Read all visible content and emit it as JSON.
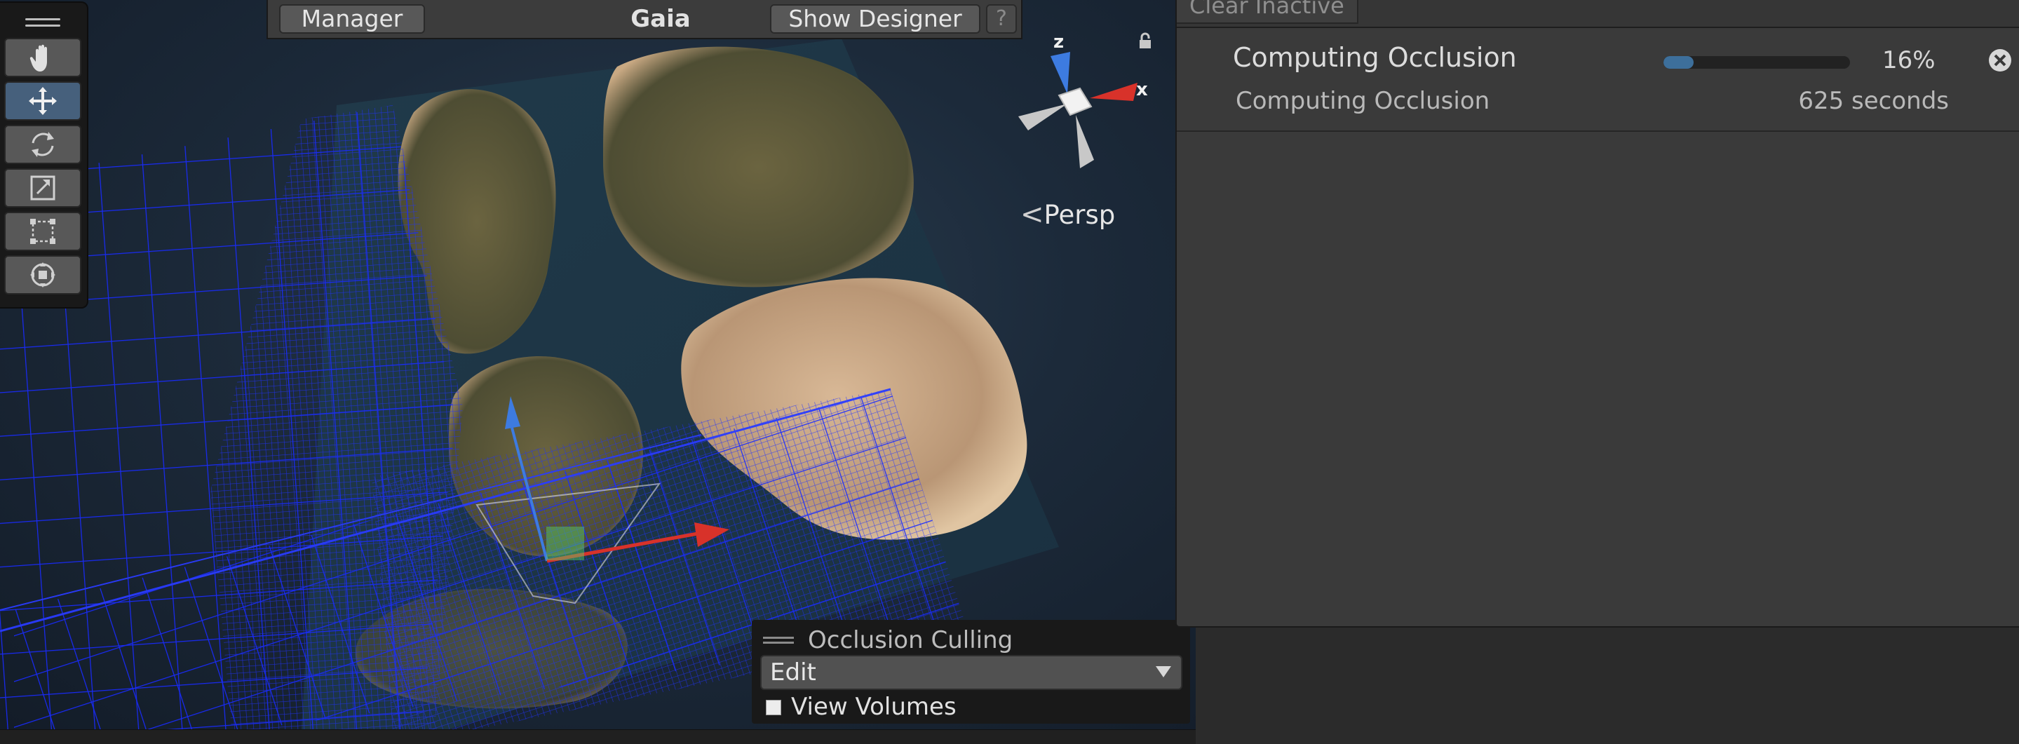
{
  "overlay_toolbar": {
    "manager_label": "Manager",
    "title": "Gaia",
    "show_designer_label": "Show Designer",
    "help_label": "?"
  },
  "tools": [
    {
      "name": "hand-tool",
      "icon": "hand-icon",
      "active": false
    },
    {
      "name": "move-tool",
      "icon": "move-arrows-icon",
      "active": true
    },
    {
      "name": "rotate-tool",
      "icon": "rotate-icon",
      "active": false
    },
    {
      "name": "scale-tool",
      "icon": "scale-icon",
      "active": false
    },
    {
      "name": "rect-tool",
      "icon": "rect-transform-icon",
      "active": false
    },
    {
      "name": "transform-tool",
      "icon": "transform-icon",
      "active": false
    }
  ],
  "gizmo": {
    "z_label": "z",
    "x_label": "x",
    "persp_label": "Persp",
    "colors": {
      "z": "#3d7be0",
      "x": "#d8322a",
      "neutral": "#c8c8c8"
    }
  },
  "occlusion_panel": {
    "title": "Occlusion Culling",
    "mode_value": "Edit",
    "view_volumes_label": "View Volumes",
    "view_volumes_checked": true
  },
  "progress_window": {
    "clear_inactive_label": "Clear Inactive",
    "task": {
      "name": "Computing Occlusion",
      "detail": "Computing Occlusion",
      "percent_label": "16%",
      "progress": 0.16,
      "time_label": "625 seconds"
    }
  },
  "colors": {
    "accent_blue": "#46607c",
    "progress_fill": "#3d6f9b",
    "wireframe_blue": "#1a2cff"
  }
}
